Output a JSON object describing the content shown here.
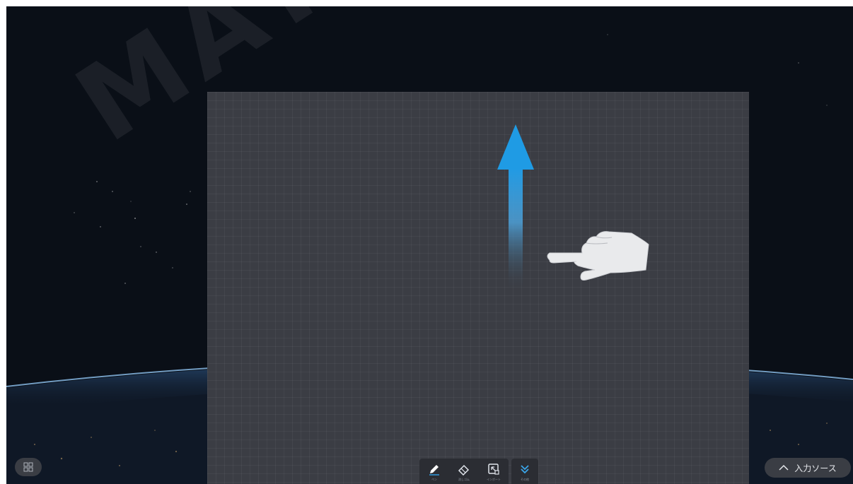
{
  "watermark": "MAYA",
  "toolbar": {
    "tools": [
      {
        "icon": "pen-icon",
        "label": "ペン"
      },
      {
        "icon": "eraser-icon",
        "label": "消しゴム"
      },
      {
        "icon": "import-icon",
        "label": "インポート"
      },
      {
        "icon": "chevron-double-down-icon",
        "label": "その他"
      }
    ]
  },
  "home_button": {
    "icon": "windows-grid-icon"
  },
  "input_source": {
    "icon": "chevron-up-icon",
    "label": "入力ソース"
  },
  "gesture_hint": {
    "arrow_icon": "arrow-up-icon",
    "hand_icon": "pointing-hand-icon",
    "direction": "up"
  },
  "colors": {
    "background": "#080d14",
    "whiteboard": "#3b3d44",
    "toolbar": "#2b2d33",
    "accent_blue": "#2f9be0",
    "icon_light": "#dfe3ea"
  }
}
